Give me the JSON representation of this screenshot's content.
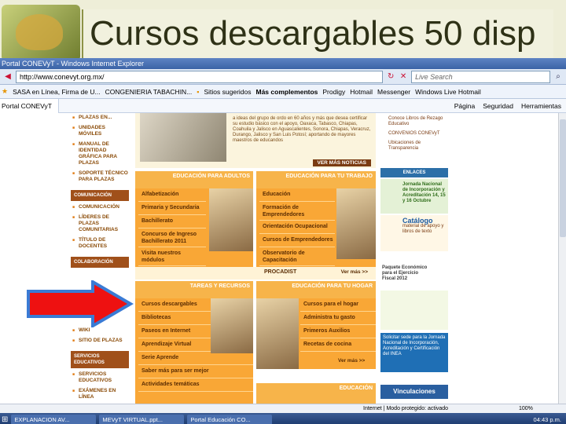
{
  "slide": {
    "title": "Cursos descargables 50 disp"
  },
  "browser": {
    "window_title": "Portal CONEVyT - Windows Internet Explorer",
    "url": "http://www.conevyt.org.mx/",
    "search_placeholder": "Live Search",
    "favorites": [
      "SASA en Línea, Firma de U...",
      "CONGENIERIA TABACHIN...",
      "Sitios sugeridos",
      "Más complementos",
      "Prodigy",
      "Hotmail",
      "Messenger",
      "Windows Live Hotmail"
    ],
    "tab_label": "Portal CONEVyT",
    "commands": [
      "Página",
      "Seguridad",
      "Herramientas"
    ],
    "status": "Internet | Modo protegido: activado",
    "zoom": "100%"
  },
  "left_nav": {
    "items_top": [
      "PLAZAS EN...",
      "UNIDADES MÓVILES",
      "MANUAL DE IDENTIDAD GRÁFICA PARA PLAZAS",
      "SOPORTE TÉCNICO PARA PLAZAS"
    ],
    "head_comunicacion": "COMUNICACIÓN",
    "items_com": [
      "COMUNICACIÓN",
      "LÍDERES DE PLAZAS COMUNITARIAS",
      "TÍTULO DE DOCENTES"
    ],
    "head_colaboracion": "COLABORACIÓN",
    "items_bottom": [
      "WIKI",
      "SITIO DE PLAZAS"
    ],
    "head_servicios": "SERVICIOS EDUCATIVOS",
    "items_serv": [
      "SERVICIOS EDUCATIVOS",
      "EXÁMENES EN LÍNEA"
    ]
  },
  "news": {
    "text": "a ideas del grupo de ordo en 60 años y más que desea certificar su estudio básico con el apoyo, Oaxaca, Tabasco, Chiapas, Coahuila y Jalisco en Aguascalientes, Sonora, Chiapas, Veracruz, Durango, Jalisco y San Luis Potosí; aportando de mayores maestros de educandos",
    "ver_mas": "VER MÁS NOTICIAS"
  },
  "sections": {
    "adultos_header": "EDUCACIÓN PARA ADULTOS",
    "adultos_links": [
      "Alfabetización",
      "Primaria y Secundaria",
      "Bachillerato",
      "Concurso de Ingreso Bachillerato 2011",
      "Visita nuestros módulos"
    ],
    "trabajo_header": "EDUCACIÓN PARA TU TRABAJO",
    "trabajo_links": [
      "Educación",
      "Formación de Emprendedores",
      "Orientación Ocupacional",
      "Cursos de Emprendedores",
      "Observatorio de Capacitación"
    ],
    "procadist": "PROCADIST",
    "ver_mas_1": "Ver más >>",
    "tareas_header": "TAREAS Y RECURSOS",
    "tareas_links": [
      "Cursos descargables",
      "Bibliotecas",
      "Paseos en Internet",
      "Aprendizaje Virtual",
      "Serie Aprende",
      "Saber más para ser mejor",
      "Actividades temáticas"
    ],
    "hogar_header": "EDUCACIÓN PARA TU HOGAR",
    "hogar_links": [
      "Cursos para el hogar",
      "Administra tu gasto",
      "Primeros Auxilios",
      "Recetas de cocina"
    ],
    "ver_mas_2": "Ver más >>",
    "bottom_header": "EDUCACIÓN"
  },
  "right_col": {
    "items": [
      "Conoce Libros de Rezago Educativo",
      "CONVENIOS CONEVyT",
      "Ubicaciones de Transparencia"
    ],
    "enlaces": "ENLACES",
    "jornada": "Jornada Nacional de Incorporación y Acreditación 14, 15 y 16 Octubre",
    "catalogo": "Catálogo",
    "catalogo_sub": "material de apoyo y libros de texto",
    "paquete": "Paquete Económico para el Ejercicio Fiscal 2012",
    "solicitar": "Solicitar sede para la Jornada Nacional de Incorporación, Acreditación y Certificación del INEA",
    "vinculaciones": "Vinculaciones"
  },
  "taskbar": {
    "items": [
      "EXPLANACION AV...",
      "MEVyT VIRTUAL.ppt...",
      "Portal Educación CO..."
    ],
    "clock": "04:43 p.m."
  },
  "colors": {
    "arrow_fill": "#ee1111",
    "arrow_stroke": "#3a7bd5",
    "orange": "#f9a736"
  }
}
